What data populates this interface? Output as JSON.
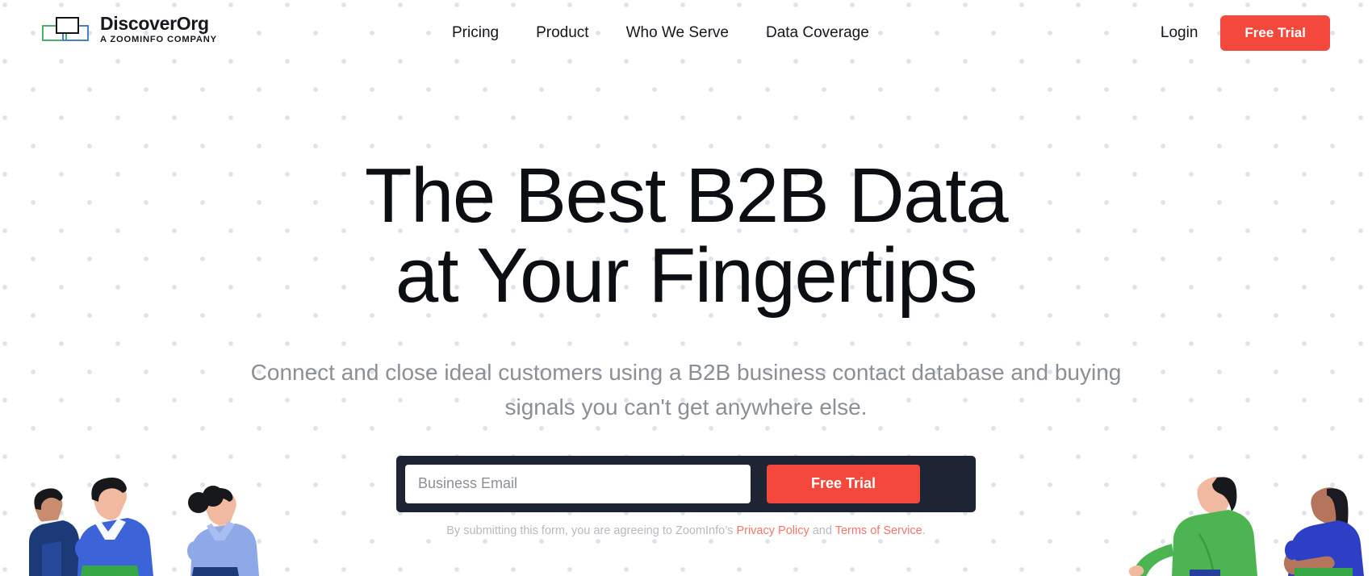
{
  "brand": {
    "logo_title": "DiscoverOrg",
    "logo_subtitle": "A ZOOMINFO COMPANY",
    "accent_red": "#f4483c",
    "form_navy": "#1d2434",
    "logo_green": "#4caf6e",
    "logo_blue": "#4a7fc9",
    "logo_black": "#111418",
    "dot_color": "#dfe3ee"
  },
  "nav": {
    "items": [
      {
        "label": "Pricing"
      },
      {
        "label": "Product"
      },
      {
        "label": "Who We Serve"
      },
      {
        "label": "Data Coverage"
      }
    ],
    "login_label": "Login",
    "trial_label": "Free Trial"
  },
  "hero": {
    "headline": "The Best B2B Data\nat Your Fingertips",
    "subheadline": "Connect and close ideal customers using a B2B business contact database and buying\nsignals you can't get anywhere else."
  },
  "form": {
    "email_placeholder": "Business Email",
    "email_value": "",
    "submit_label": "Free Trial",
    "legal_prefix": "By submitting this form, you are agreeing to ZoomInfo’s ",
    "legal_link1": "Privacy Policy",
    "legal_middle": " and ",
    "legal_link2": "Terms of Service",
    "legal_suffix": "."
  },
  "illustrations": {
    "left_alt": "three people looking upward",
    "right_alt": "two people looking upward"
  }
}
